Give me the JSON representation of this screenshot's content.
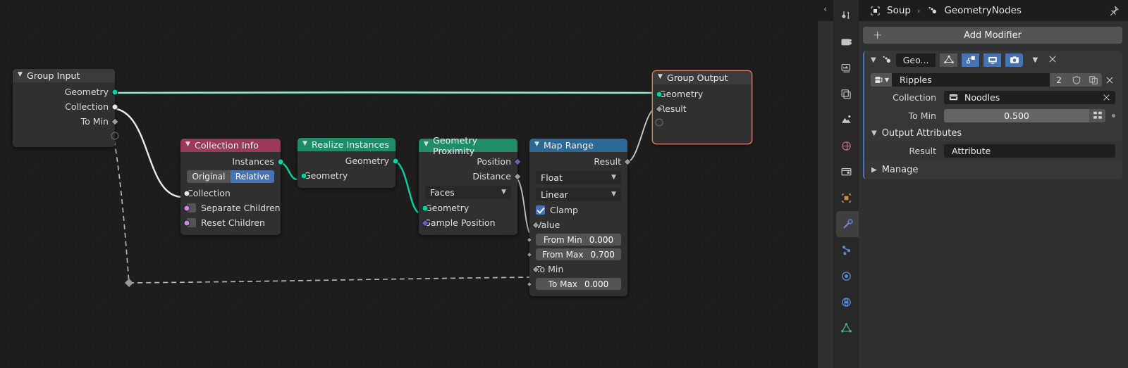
{
  "editor": {
    "background": "#1d1d1d",
    "nodes": [
      {
        "id": "group-input",
        "title": "Group Input",
        "header_color": "#3b3b3b",
        "outputs": [
          {
            "label": "Geometry",
            "socket": "geo"
          },
          {
            "label": "Collection",
            "socket": "white"
          },
          {
            "label": "To Min",
            "socket": "grey-diamond"
          },
          {
            "label": "",
            "socket": "hollow"
          }
        ]
      },
      {
        "id": "collection-info",
        "title": "Collection Info",
        "header_color": "#9c3858",
        "outputs": [
          {
            "label": "Instances",
            "socket": "geo"
          }
        ],
        "toggle": {
          "options": [
            "Original",
            "Relative"
          ],
          "selected": "Relative"
        },
        "inputs": [
          {
            "label": "Collection",
            "socket": "white"
          },
          {
            "label": "Separate Children",
            "socket": "violet",
            "checkbox": false
          },
          {
            "label": "Reset Children",
            "socket": "violet",
            "checkbox": false
          }
        ]
      },
      {
        "id": "realize-instances",
        "title": "Realize Instances",
        "header_color": "#1f8c6b",
        "outputs": [
          {
            "label": "Geometry",
            "socket": "geo"
          }
        ],
        "inputs": [
          {
            "label": "Geometry",
            "socket": "geo"
          }
        ]
      },
      {
        "id": "geometry-proximity",
        "title": "Geometry Proximity",
        "header_color": "#1f8c6b",
        "outputs": [
          {
            "label": "Position",
            "socket": "purple-diamond"
          },
          {
            "label": "Distance",
            "socket": "grey-diamond"
          }
        ],
        "dropdown": "Faces",
        "inputs": [
          {
            "label": "Geometry",
            "socket": "geo"
          },
          {
            "label": "Sample Position",
            "socket": "purple-diamond"
          }
        ]
      },
      {
        "id": "map-range",
        "title": "Map Range",
        "header_color": "#2c6896",
        "outputs": [
          {
            "label": "Result",
            "socket": "grey-diamond"
          }
        ],
        "dropdowns": [
          "Float",
          "Linear"
        ],
        "checkbox": {
          "label": "Clamp",
          "checked": true
        },
        "inputs": [
          {
            "label": "Value",
            "socket": "grey-diamond"
          },
          {
            "label": "From Min",
            "value": "0.000",
            "socket": "grey-diamond-small"
          },
          {
            "label": "From Max",
            "value": "0.700",
            "socket": "grey-diamond-small"
          },
          {
            "label": "To Min",
            "socket": "grey-diamond"
          },
          {
            "label": "To Max",
            "value": "0.000",
            "socket": "grey-diamond-small"
          }
        ]
      },
      {
        "id": "group-output",
        "title": "Group Output",
        "header_color": "#3b3b3b",
        "selected": true,
        "inputs": [
          {
            "label": "Geometry",
            "socket": "geo"
          },
          {
            "label": "Result",
            "socket": "grey-diamond"
          },
          {
            "label": "",
            "socket": "hollow"
          }
        ]
      }
    ],
    "link_colors": {
      "geometry": "#9ce8cf",
      "value": "#bdbdbd",
      "field_dashed": "#b4b4b4"
    }
  },
  "properties": {
    "breadcrumb": {
      "object": "Soup",
      "modifier": "GeometryNodes",
      "separator": "›"
    },
    "add_modifier": "Add Modifier",
    "modifier": {
      "chip_label": "Geo...",
      "name": "Ripples",
      "users_count": "2",
      "toggles": [
        {
          "name": "edit-mode-toggle",
          "active": false
        },
        {
          "name": "show-in-editmode-toggle",
          "active": true
        },
        {
          "name": "realtime-display-toggle",
          "active": true
        },
        {
          "name": "render-toggle",
          "active": true
        }
      ]
    },
    "inputs": [
      {
        "label": "Collection",
        "value": "Noodles",
        "type": "collection"
      },
      {
        "label": "To Min",
        "value": "0.500",
        "type": "number"
      }
    ],
    "output_attributes": {
      "header": "Output Attributes",
      "rows": [
        {
          "label": "Result",
          "value": "Attribute"
        }
      ]
    },
    "manage": "Manage",
    "accent_color": "#4772b3"
  }
}
